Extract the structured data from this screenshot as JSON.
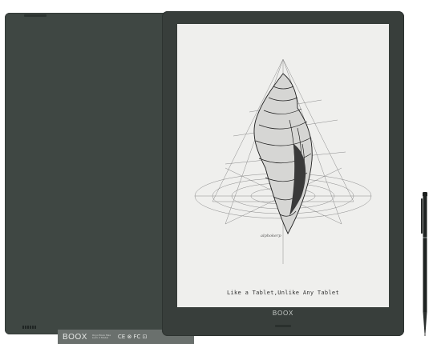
{
  "back": {
    "brand": "BOOX",
    "spec_text": "Onyx Boox Max Lumi 2 Model",
    "cert_marks": "CE ⊗ FC ⊡"
  },
  "front": {
    "brand": "BOOX",
    "tagline": "Like a Tablet,Unlike Any Tablet",
    "signature": "alphokerp"
  }
}
